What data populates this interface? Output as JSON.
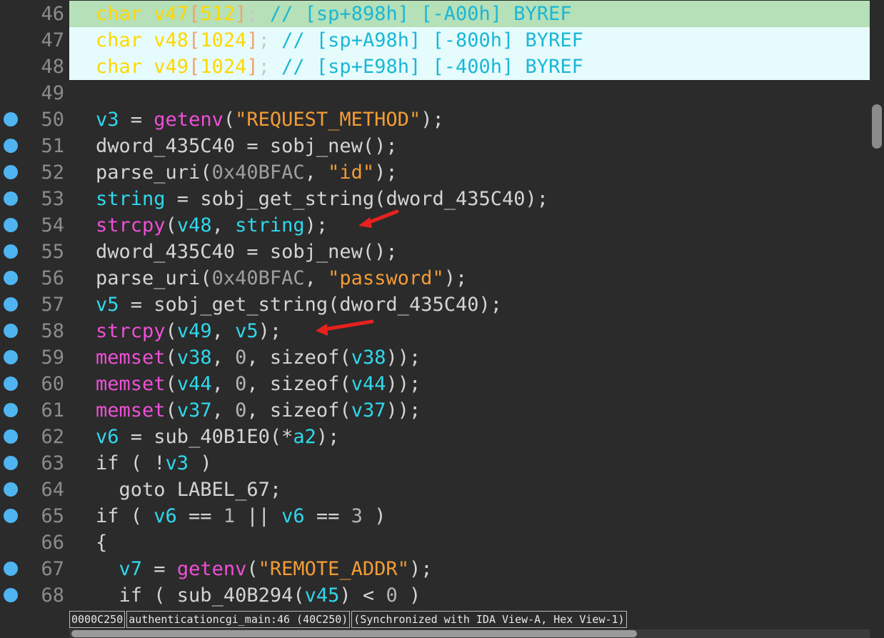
{
  "lines": [
    {
      "no": "46",
      "bp": false,
      "hl": "green",
      "tokens": [
        [
          "char",
          "kw"
        ],
        [
          " v47",
          "kw"
        ],
        [
          "[",
          "brk"
        ],
        [
          "512",
          "kw"
        ],
        [
          "]",
          "brk"
        ],
        [
          ";",
          "pun"
        ],
        [
          " // ",
          "cmt"
        ],
        [
          "[sp+898h]",
          "cmt"
        ],
        [
          " ",
          "cmt"
        ],
        [
          "[-A00h]",
          "cmt"
        ],
        [
          " BYREF",
          "cmt"
        ]
      ]
    },
    {
      "no": "47",
      "bp": false,
      "hl": "cyan",
      "tokens": [
        [
          "char",
          "kw"
        ],
        [
          " v48",
          "kw"
        ],
        [
          "[",
          "brk"
        ],
        [
          "1024",
          "kw"
        ],
        [
          "]",
          "brk"
        ],
        [
          ";",
          "pun"
        ],
        [
          " // ",
          "cmt"
        ],
        [
          "[sp+A98h]",
          "cmt"
        ],
        [
          " ",
          "cmt"
        ],
        [
          "[-800h]",
          "cmt"
        ],
        [
          " BYREF",
          "cmt"
        ]
      ]
    },
    {
      "no": "48",
      "bp": false,
      "hl": "cyan",
      "tokens": [
        [
          "char",
          "kw"
        ],
        [
          " v49",
          "kw"
        ],
        [
          "[",
          "brk"
        ],
        [
          "1024",
          "kw"
        ],
        [
          "]",
          "brk"
        ],
        [
          ";",
          "pun"
        ],
        [
          " // ",
          "cmt"
        ],
        [
          "[sp+E98h]",
          "cmt"
        ],
        [
          " ",
          "cmt"
        ],
        [
          "[-400h]",
          "cmt"
        ],
        [
          " BYREF",
          "cmt"
        ]
      ]
    },
    {
      "no": "49",
      "bp": false,
      "hl": "",
      "tokens": []
    },
    {
      "no": "50",
      "bp": true,
      "hl": "",
      "tokens": [
        [
          "v3",
          "var"
        ],
        [
          " = ",
          "def"
        ],
        [
          "getenv",
          "fn"
        ],
        [
          "(",
          "def"
        ],
        [
          "\"REQUEST_METHOD\"",
          "str"
        ],
        [
          ");",
          "def"
        ]
      ]
    },
    {
      "no": "51",
      "bp": true,
      "hl": "",
      "tokens": [
        [
          "dword_435C40",
          "def"
        ],
        [
          " = ",
          "def"
        ],
        [
          "sobj_new",
          "def"
        ],
        [
          "();",
          "def"
        ]
      ]
    },
    {
      "no": "52",
      "bp": true,
      "hl": "",
      "tokens": [
        [
          "parse_uri",
          "def"
        ],
        [
          "(",
          "def"
        ],
        [
          "0x40BFAC",
          "hexg"
        ],
        [
          ", ",
          "def"
        ],
        [
          "\"id\"",
          "str"
        ],
        [
          ");",
          "def"
        ]
      ]
    },
    {
      "no": "53",
      "bp": true,
      "hl": "",
      "tokens": [
        [
          "string",
          "var"
        ],
        [
          " = ",
          "def"
        ],
        [
          "sobj_get_string",
          "def"
        ],
        [
          "(",
          "def"
        ],
        [
          "dword_435C40",
          "def"
        ],
        [
          ");",
          "def"
        ]
      ]
    },
    {
      "no": "54",
      "bp": true,
      "hl": "",
      "tokens": [
        [
          "strcpy",
          "fn"
        ],
        [
          "(",
          "def"
        ],
        [
          "v48",
          "var"
        ],
        [
          ", ",
          "def"
        ],
        [
          "string",
          "var"
        ],
        [
          ");",
          "def"
        ]
      ]
    },
    {
      "no": "55",
      "bp": true,
      "hl": "",
      "tokens": [
        [
          "dword_435C40",
          "def"
        ],
        [
          " = ",
          "def"
        ],
        [
          "sobj_new",
          "def"
        ],
        [
          "();",
          "def"
        ]
      ]
    },
    {
      "no": "56",
      "bp": true,
      "hl": "",
      "tokens": [
        [
          "parse_uri",
          "def"
        ],
        [
          "(",
          "def"
        ],
        [
          "0x40BFAC",
          "hexg"
        ],
        [
          ", ",
          "def"
        ],
        [
          "\"password\"",
          "str"
        ],
        [
          ");",
          "def"
        ]
      ]
    },
    {
      "no": "57",
      "bp": true,
      "hl": "",
      "tokens": [
        [
          "v5",
          "var"
        ],
        [
          " = ",
          "def"
        ],
        [
          "sobj_get_string",
          "def"
        ],
        [
          "(",
          "def"
        ],
        [
          "dword_435C40",
          "def"
        ],
        [
          ");",
          "def"
        ]
      ]
    },
    {
      "no": "58",
      "bp": true,
      "hl": "",
      "tokens": [
        [
          "strcpy",
          "fn"
        ],
        [
          "(",
          "def"
        ],
        [
          "v49",
          "var"
        ],
        [
          ", ",
          "def"
        ],
        [
          "v5",
          "var"
        ],
        [
          ");",
          "def"
        ]
      ]
    },
    {
      "no": "59",
      "bp": true,
      "hl": "",
      "tokens": [
        [
          "memset",
          "fn"
        ],
        [
          "(",
          "def"
        ],
        [
          "v38",
          "var"
        ],
        [
          ", ",
          "def"
        ],
        [
          "0",
          "num"
        ],
        [
          ", ",
          "def"
        ],
        [
          "sizeof",
          "def"
        ],
        [
          "(",
          "def"
        ],
        [
          "v38",
          "var"
        ],
        [
          "));",
          "def"
        ]
      ]
    },
    {
      "no": "60",
      "bp": true,
      "hl": "",
      "tokens": [
        [
          "memset",
          "fn"
        ],
        [
          "(",
          "def"
        ],
        [
          "v44",
          "var"
        ],
        [
          ", ",
          "def"
        ],
        [
          "0",
          "num"
        ],
        [
          ", ",
          "def"
        ],
        [
          "sizeof",
          "def"
        ],
        [
          "(",
          "def"
        ],
        [
          "v44",
          "var"
        ],
        [
          "));",
          "def"
        ]
      ]
    },
    {
      "no": "61",
      "bp": true,
      "hl": "",
      "tokens": [
        [
          "memset",
          "fn"
        ],
        [
          "(",
          "def"
        ],
        [
          "v37",
          "var"
        ],
        [
          ", ",
          "def"
        ],
        [
          "0",
          "num"
        ],
        [
          ", ",
          "def"
        ],
        [
          "sizeof",
          "def"
        ],
        [
          "(",
          "def"
        ],
        [
          "v37",
          "var"
        ],
        [
          "));",
          "def"
        ]
      ]
    },
    {
      "no": "62",
      "bp": true,
      "hl": "",
      "tokens": [
        [
          "v6",
          "var"
        ],
        [
          " = ",
          "def"
        ],
        [
          "sub_40B1E0",
          "def"
        ],
        [
          "(*",
          "def"
        ],
        [
          "a2",
          "var"
        ],
        [
          ");",
          "def"
        ]
      ]
    },
    {
      "no": "63",
      "bp": true,
      "hl": "",
      "tokens": [
        [
          "if ( !",
          "def"
        ],
        [
          "v3",
          "var"
        ],
        [
          " )",
          "def"
        ]
      ]
    },
    {
      "no": "64",
      "bp": true,
      "hl": "",
      "tokens": [
        [
          "  goto LABEL_67;",
          "def"
        ]
      ]
    },
    {
      "no": "65",
      "bp": true,
      "hl": "",
      "tokens": [
        [
          "if ( ",
          "def"
        ],
        [
          "v6",
          "var"
        ],
        [
          " == ",
          "def"
        ],
        [
          "1",
          "num"
        ],
        [
          " || ",
          "def"
        ],
        [
          "v6",
          "var"
        ],
        [
          " == ",
          "def"
        ],
        [
          "3",
          "num"
        ],
        [
          " )",
          "def"
        ]
      ]
    },
    {
      "no": "66",
      "bp": false,
      "hl": "",
      "tokens": [
        [
          "{",
          "def"
        ]
      ]
    },
    {
      "no": "67",
      "bp": true,
      "hl": "",
      "tokens": [
        [
          "  ",
          "def"
        ],
        [
          "v7",
          "var"
        ],
        [
          " = ",
          "def"
        ],
        [
          "getenv",
          "fn"
        ],
        [
          "(",
          "def"
        ],
        [
          "\"REMOTE_ADDR\"",
          "str"
        ],
        [
          ");",
          "def"
        ]
      ]
    },
    {
      "no": "68",
      "bp": true,
      "hl": "",
      "tokens": [
        [
          "  if ( ",
          "def"
        ],
        [
          "sub_40B294",
          "def"
        ],
        [
          "(",
          "def"
        ],
        [
          "v45",
          "var"
        ],
        [
          ") < ",
          "def"
        ],
        [
          "0",
          "num"
        ],
        [
          " )",
          "def"
        ]
      ]
    }
  ],
  "status": {
    "offset": "0000C250",
    "location": "authenticationcgi_main:46 (40C250)",
    "sync": "(Synchronized with IDA View-A, Hex View-1)"
  },
  "annotations": [
    "red-arrow-line-54",
    "red-arrow-line-58"
  ],
  "colors": {
    "background": "#2b2b2b",
    "highlight_current": "#b5e0b8",
    "highlight_selected": "#e6fcfc",
    "breakpoint_dot": "#4fb4f0",
    "annotation_arrow": "#e8211f"
  }
}
